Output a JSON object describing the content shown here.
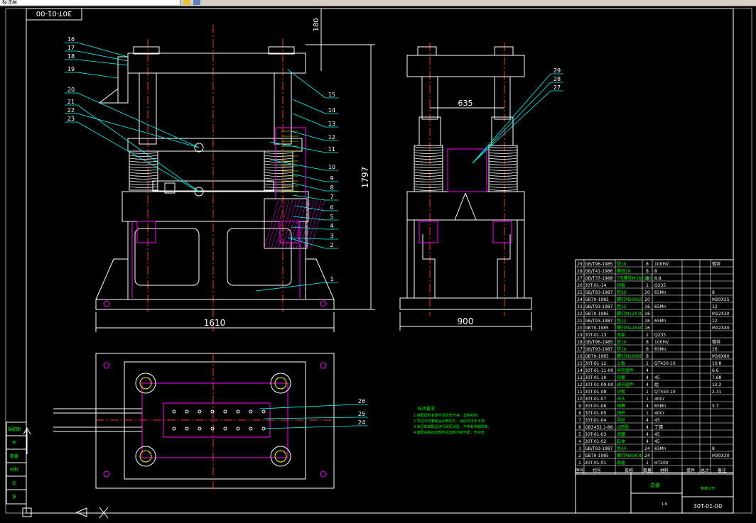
{
  "toolbar": {
    "layer_field": "标注层"
  },
  "drawing_number_tag": "30T-01-00",
  "dimensions": {
    "top_offset": "180",
    "height": "1797",
    "width_front": "1610",
    "width_side": "900",
    "column_spacing": "635"
  },
  "balloons_front": [
    "1",
    "2",
    "3",
    "4",
    "5",
    "6",
    "7",
    "8",
    "9",
    "10",
    "11",
    "12",
    "13",
    "14",
    "15",
    "16",
    "17",
    "18",
    "19",
    "20",
    "21",
    "22",
    "23"
  ],
  "balloons_side": [
    "27",
    "28",
    "29"
  ],
  "balloons_top": [
    "24",
    "25",
    "26"
  ],
  "colors": {
    "background": "#000000",
    "frame": "#ffffff",
    "outline": "#ffffff",
    "centerline": "#ff3030",
    "leader": "#00ffff",
    "part": "#ff00ff",
    "notes": "#00ff00",
    "dim": "#ffffff",
    "bolt": "#ffff00"
  },
  "left_panel": [
    "装配图",
    "件",
    "数量",
    "材料",
    "比",
    "张"
  ],
  "title_block": {
    "title": "总装",
    "drawing_no": "30T-01-00",
    "scale": "1:8",
    "company": "某某公司"
  },
  "bom_rows": [
    {
      "no": "29",
      "code": "GB/T96-1985",
      "name": "垫16",
      "qty": "8",
      "mat": "100HV",
      "note": "镀锌"
    },
    {
      "no": "28",
      "code": "GB/T41-1986",
      "name": "螺母16",
      "qty": "8",
      "mat": "8",
      "note": ""
    },
    {
      "no": "27",
      "code": "GB/T37-1988",
      "name": "T形螺栓M16X135",
      "qty": "8",
      "mat": "8.8",
      "note": ""
    },
    {
      "no": "26",
      "code": "30T-01-14",
      "name": "挡板",
      "qty": "1",
      "mat": "Q235",
      "note": ""
    },
    {
      "no": "25",
      "code": "GB/T93-1987",
      "name": "垫20",
      "qty": "20",
      "mat": "65Mn",
      "note": "8"
    },
    {
      "no": "24",
      "code": "GB70-1985",
      "name": "螺钉M20X25",
      "qty": "20",
      "mat": "",
      "note": "M20X25"
    },
    {
      "no": "23",
      "code": "GB/T93-1987",
      "name": "垫12",
      "qty": "16",
      "mat": "65Mn",
      "note": "12"
    },
    {
      "no": "22",
      "code": "GB70-1985",
      "name": "螺钉M12X30",
      "qty": "16",
      "mat": "",
      "note": "M12X30"
    },
    {
      "no": "21",
      "code": "GB/T93-1987",
      "name": "垫12",
      "qty": "16",
      "mat": "65Mn",
      "note": "12"
    },
    {
      "no": "20",
      "code": "GB70-1985",
      "name": "螺钉M12X40",
      "qty": "16",
      "mat": "",
      "note": "M12X40"
    },
    {
      "no": "19",
      "code": "30T-01-13",
      "name": "支架",
      "qty": "2",
      "mat": "Q235",
      "note": ""
    },
    {
      "no": "18",
      "code": "GB/T96-1985",
      "name": "垫16",
      "qty": "8",
      "mat": "100HV",
      "note": "镀锌"
    },
    {
      "no": "17",
      "code": "GB/T93-1987",
      "name": "垫16",
      "qty": "8",
      "mat": "65Mn",
      "note": "16"
    },
    {
      "no": "16",
      "code": "GB70-1985",
      "name": "螺钉M16X80",
      "qty": "8",
      "mat": "",
      "note": "M16X80"
    },
    {
      "no": "15",
      "code": "30T-01-12",
      "name": "上板",
      "qty": "1",
      "mat": "QT450-10",
      "note": "10.8"
    },
    {
      "no": "14",
      "code": "30T-01-11-00",
      "name": "导柱组件",
      "qty": "4",
      "mat": "",
      "note": "6.6"
    },
    {
      "no": "13",
      "code": "30T-01-10",
      "name": "导套",
      "qty": "4",
      "mat": "45",
      "note": "7.68"
    },
    {
      "no": "12",
      "code": "30T-01-09-00",
      "name": "调节组件",
      "qty": "4",
      "mat": "组",
      "note": "12.2"
    },
    {
      "no": "11",
      "code": "30T-01-08",
      "name": "中板",
      "qty": "1",
      "mat": "QT450-10",
      "note": "2.31"
    },
    {
      "no": "10",
      "code": "30T-01-07",
      "name": "压头",
      "qty": "1",
      "mat": "40Cr",
      "note": ""
    },
    {
      "no": "9",
      "code": "30T-01-06",
      "name": "弹簧",
      "qty": "4",
      "mat": "65Mn",
      "note": "5.7"
    },
    {
      "no": "8",
      "code": "30T-01-05",
      "name": "顶杆",
      "qty": "1",
      "mat": "40Cr",
      "note": ""
    },
    {
      "no": "7",
      "code": "30T-01-04",
      "name": "导柱",
      "qty": "4",
      "mat": "45",
      "note": ""
    },
    {
      "no": "6",
      "code": "GB3452.1-88",
      "name": "O形圈",
      "qty": "4",
      "mat": "丁腈",
      "note": ""
    },
    {
      "no": "5",
      "code": "30T-01-03",
      "name": "活塞",
      "qty": "4",
      "mat": "45",
      "note": ""
    },
    {
      "no": "4",
      "code": "30T-01-02",
      "name": "缸体",
      "qty": "4",
      "mat": "45",
      "note": ""
    },
    {
      "no": "3",
      "code": "GB/T93-1987",
      "name": "垫30",
      "qty": "24",
      "mat": "65Mn",
      "note": "8"
    },
    {
      "no": "2",
      "code": "GB70-1985",
      "name": "螺钉M30X30",
      "qty": "24",
      "mat": "",
      "note": "M30X30"
    },
    {
      "no": "1",
      "code": "30T-01-01",
      "name": "底座",
      "qty": "1",
      "mat": "HT200",
      "note": ""
    }
  ],
  "bom_header": [
    "序号",
    "代号",
    "名称",
    "数量",
    "材料",
    "单件",
    "总计",
    "备注"
  ],
  "notes": {
    "title": "技术要求",
    "lines": [
      "1.装配前所有零件须清洗干净，去除毛刺。",
      "2.导柱与导套配合间隙均匀，运动灵活无卡滞。",
      "3.液压缸装配后进行耐压试验，不得有渗漏现象。",
      "4.装配后各运动部件应运转平稳可靠，无冲击。"
    ]
  }
}
